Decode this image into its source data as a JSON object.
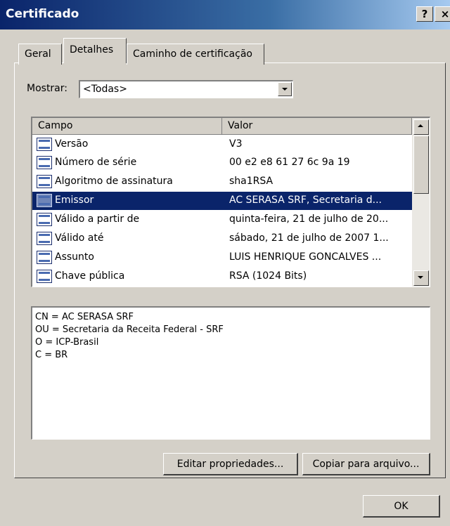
{
  "window": {
    "title": "Certificado",
    "help_label": "?",
    "close_label": "×"
  },
  "tabs": [
    {
      "label": "Geral"
    },
    {
      "label": "Detalhes"
    },
    {
      "label": "Caminho de certificação"
    }
  ],
  "show": {
    "label": "Mostrar:",
    "value": "<Todas>"
  },
  "list": {
    "headers": {
      "field": "Campo",
      "value": "Valor"
    },
    "rows": [
      {
        "field": "Versão",
        "value": "V3"
      },
      {
        "field": "Número de série",
        "value": "00 e2 e8 61 27 6c 9a 19"
      },
      {
        "field": "Algoritmo de assinatura",
        "value": "sha1RSA"
      },
      {
        "field": "Emissor",
        "value": "AC SERASA SRF, Secretaria d..."
      },
      {
        "field": "Válido a partir de",
        "value": "quinta-feira, 21 de julho de 20..."
      },
      {
        "field": "Válido até",
        "value": "sábado, 21 de julho de 2007 1..."
      },
      {
        "field": "Assunto",
        "value": "LUIS HENRIQUE GONCALVES ..."
      },
      {
        "field": "Chave pública",
        "value": "RSA (1024 Bits)"
      }
    ],
    "selected_index": 3
  },
  "detail": {
    "lines": [
      "CN = AC SERASA SRF",
      "OU = Secretaria da Receita Federal - SRF",
      "O = ICP-Brasil",
      "C = BR"
    ]
  },
  "buttons": {
    "edit": "Editar propriedades...",
    "copy": "Copiar para arquivo...",
    "ok": "OK"
  },
  "colors": {
    "title_bar": "#0a246a",
    "selection": "#0a246a",
    "face": "#d4d0c8"
  }
}
